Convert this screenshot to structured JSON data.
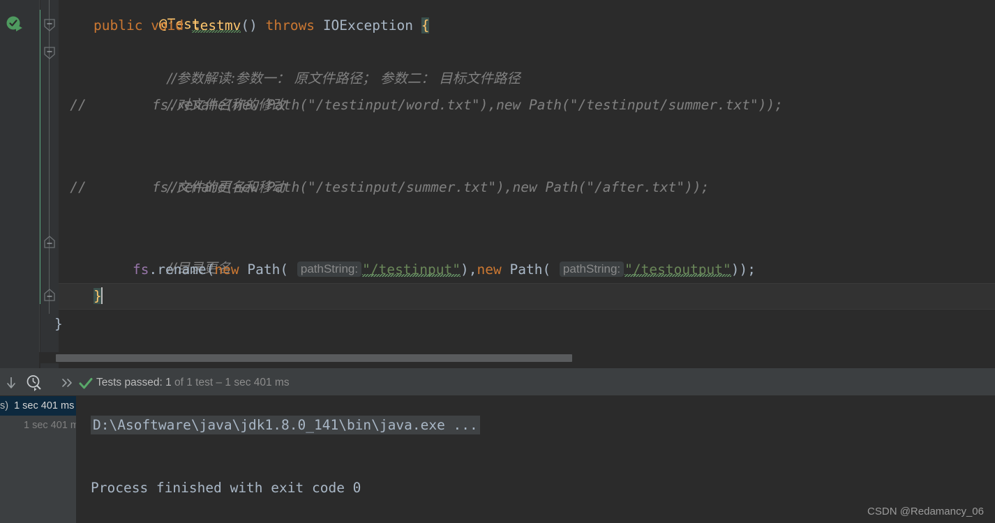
{
  "app": {
    "theme": "darcula"
  },
  "editor": {
    "gutter": {
      "run_icon_name": "run-test-green-icon",
      "fold_markers": [
        "fold-collapse-1",
        "fold-collapse-2",
        "fold-end-1",
        "fold-end-2"
      ],
      "commented_markers": [
        "//",
        "//"
      ]
    },
    "lines": [
      {
        "n": 1,
        "indent": "",
        "text": "@Test",
        "kind": "annotation"
      },
      {
        "n": 2,
        "indent": "",
        "text": "public void testmv() throws IOException {",
        "kind": "signature",
        "tokens": {
          "mod": "public",
          "ret": "void",
          "name": "testmv",
          "parens": "()",
          "throws": "throws",
          "exception": "IOException",
          "open_brace": "{"
        }
      },
      {
        "n": 3,
        "indent": "    ",
        "text": "//参数解读:参数一： 原文件路径； 参数二： 目标文件路径",
        "kind": "comment"
      },
      {
        "n": 4,
        "indent": "    ",
        "text": "//对文件名称的修改",
        "kind": "comment"
      },
      {
        "n": 5,
        "indent": "      ",
        "text": "fs.rename(new Path(\"/testinput/word.txt\"),new Path(\"/testinput/summer.txt\"));",
        "kind": "commented-code",
        "marker": "//"
      },
      {
        "n": 6,
        "indent": "",
        "text": "",
        "kind": "blank"
      },
      {
        "n": 7,
        "indent": "    ",
        "text": "//文件的更名和移动",
        "kind": "comment"
      },
      {
        "n": 8,
        "indent": "      ",
        "text": "fs.rename(new Path(\"/testinput/summer.txt\"),new Path(\"/after.txt\"));",
        "kind": "commented-code",
        "marker": "//"
      },
      {
        "n": 9,
        "indent": "",
        "text": "",
        "kind": "blank"
      },
      {
        "n": 10,
        "indent": "    ",
        "text": "//目录更名",
        "kind": "comment"
      },
      {
        "n": 11,
        "indent": "    ",
        "text": "fs.rename(new Path( pathString: \"/testinput\"),new Path( pathString: \"/testoutput\"));",
        "kind": "code"
      },
      {
        "n": 12,
        "indent": "  ",
        "text": "}",
        "kind": "close-brace-method"
      },
      {
        "n": 13,
        "indent": "",
        "text": "}",
        "kind": "close-brace-class"
      }
    ],
    "code": {
      "annotation": "@Test",
      "kw_public": "public",
      "kw_void": "void",
      "method_name": "testmv",
      "parens": "()",
      "kw_throws": "throws",
      "exception": "IOException",
      "brace_open": "{",
      "comment_params": "//参数解读:参数一： 原文件路径； 参数二： 目标文件路径",
      "comment_rename_file": "//对文件名称的修改",
      "comment_rename_move": "//文件的更名和移动",
      "comment_rename_dir": "//目录更名",
      "cmt_marker": "//",
      "line5": "fs.rename(new Path(\"/testinput/word.txt\"),new Path(\"/testinput/summer.txt\"));",
      "line8": "fs.rename(new Path(\"/testinput/summer.txt\"),new Path(\"/after.txt\"));",
      "active": {
        "obj": "fs",
        "dot": ".",
        "method": "rename",
        "lparen": "(",
        "kw_new": "new",
        "type_path": "Path",
        "hint_label": "pathString:",
        "arg1": "\"/testinput\"",
        "mid": "),",
        "arg2": "\"/testoutput\"",
        "tail": "));"
      },
      "brace_close_method": "}",
      "brace_close_class": "}"
    },
    "colors": {
      "background": "#2b2b2b",
      "gutter": "#313335",
      "keyword": "#cc7832",
      "method_decl": "#ffc66d",
      "field": "#9876aa",
      "string": "#6a8759",
      "comment": "#808080",
      "default_text": "#a9b7c6",
      "brace_match_bg": "#3b514d",
      "change_marker": "#57a07a",
      "caret_line": "#323232"
    },
    "scrollbar": {
      "name": "horizontal-scrollbar",
      "thumb_color": "#595b5d"
    }
  },
  "test_panel": {
    "toolbar": {
      "scroll_to_end_icon": "down-arrow-icon",
      "sort_by_duration_icon": "clock-magnifier-icon",
      "expand_icon": "»",
      "result_icon": "green-check-icon"
    },
    "status": {
      "passed_label": "Tests passed: ",
      "passed_count": "1",
      "of_label": " of 1 test ",
      "separator": "– ",
      "duration": "1 sec 401 ms"
    },
    "tree": [
      {
        "label": "s)",
        "duration": "1 sec 401 ms",
        "selected": true
      },
      {
        "label": "",
        "duration": "1 sec 401 ms",
        "selected": false
      }
    ],
    "console": {
      "command": "D:\\Asoftware\\java\\jdk1.8.0_141\\bin\\java.exe ...",
      "result": "Process finished with exit code 0"
    }
  },
  "watermark": {
    "text": "CSDN @Redamancy_06"
  }
}
